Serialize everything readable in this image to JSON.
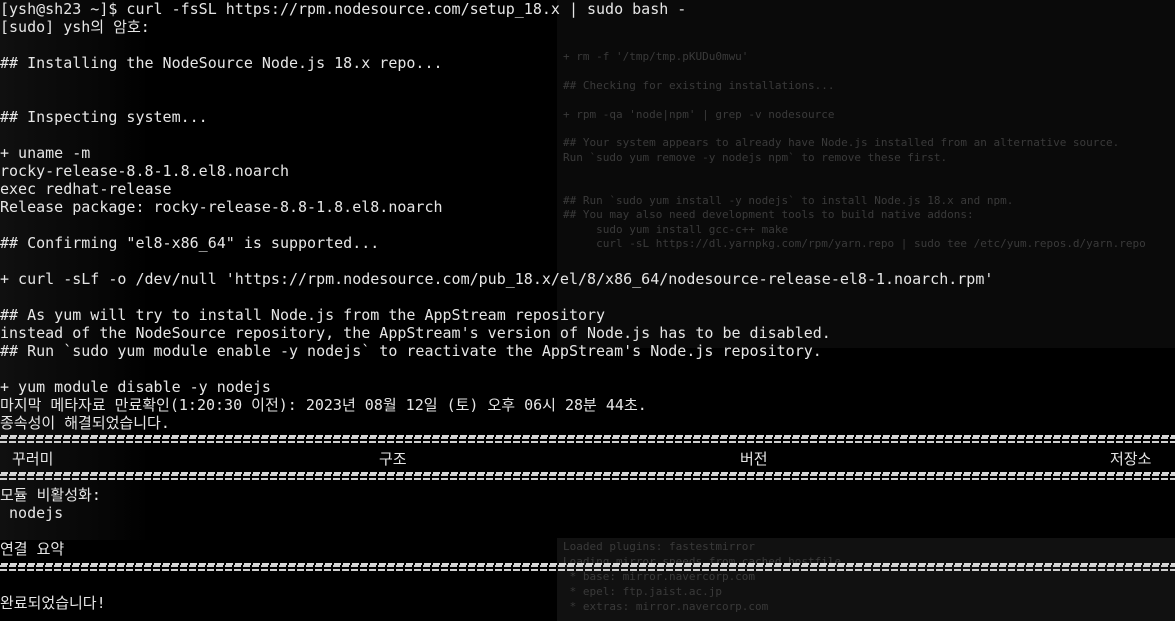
{
  "terminal": {
    "lines": [
      "[ysh@sh23 ~]$ curl -fsSL https://rpm.nodesource.com/setup_18.x | sudo bash -",
      "[sudo] ysh의 암호:",
      "",
      "## Installing the NodeSource Node.js 18.x repo...",
      "",
      "",
      "## Inspecting system...",
      "",
      "+ uname -m",
      "rocky-release-8.8-1.8.el8.noarch",
      "exec redhat-release",
      "Release package: rocky-release-8.8-1.8.el8.noarch",
      "",
      "## Confirming \"el8-x86_64\" is supported...",
      "",
      "+ curl -sLf -o /dev/null 'https://rpm.nodesource.com/pub_18.x/el/8/x86_64/nodesource-release-el8-1.noarch.rpm'",
      "",
      "## As yum will try to install Node.js from the AppStream repository",
      "instead of the NodeSource repository, the AppStream's version of Node.js has to be disabled.",
      "## Run `sudo yum module enable -y nodejs` to reactivate the AppStream's Node.js repository.",
      "",
      "+ yum module disable -y nodejs",
      "마지막 메타자료 만료확인(1:20:30 이전): 2023년 08월 12일 (토) 오후 06시 28분 44초.",
      "종속성이 해결되었습니다."
    ],
    "table_headers": [
      "꾸러미",
      "구조",
      "버전",
      "저장소"
    ],
    "after_lines": [
      "모듈 비활성화:",
      " nodejs",
      "",
      "연결 요약",
      "",
      "완료되었습니다!"
    ]
  },
  "background": {
    "ghost_lines": [
      "+ rm -f '/tmp/tmp.pKUDu0mwu'",
      "",
      "## Checking for existing installations...",
      "",
      "+ rpm -qa 'node|npm' | grep -v nodesource",
      "",
      "## Your system appears to already have Node.js installed from an alternative source.",
      "Run `sudo yum remove -y nodejs npm` to remove these first.",
      "",
      "",
      "## Run `sudo yum install -y nodejs` to install Node.js 18.x and npm.",
      "## You may also need development tools to build native addons:",
      "     sudo yum install gcc-c++ make",
      "     curl -sL https://dl.yarnpkg.com/rpm/yarn.repo | sudo tee /etc/yum.repos.d/yarn.repo"
    ],
    "ghost_bottom": [
      "Loaded plugins: fastestmirror",
      "Loading mirror speeds from cached hostfile",
      " * base: mirror.navercorp.com",
      " * epel: ftp.jaist.ac.jp",
      " * extras: mirror.navercorp.com"
    ]
  }
}
